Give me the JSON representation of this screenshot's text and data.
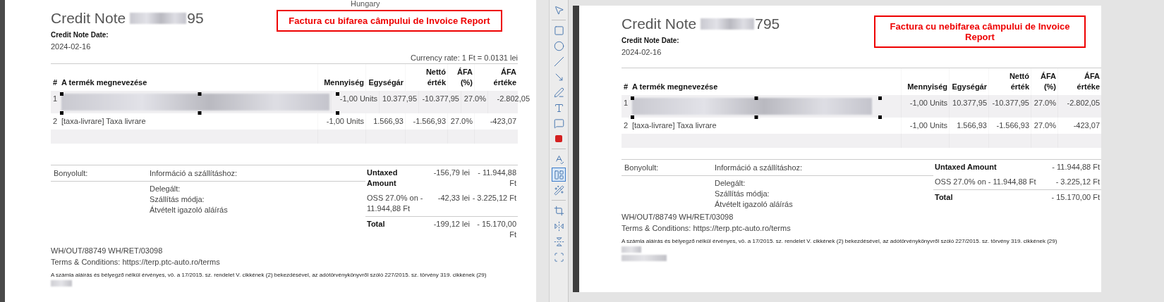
{
  "left_document": {
    "header_cut": "Hungary",
    "title": "Credit Note",
    "number_suffix": "95",
    "date_label": "Credit Note Date:",
    "date": "2024-02-16",
    "note": "Factura cu bifarea câmpului de Invoice Report",
    "currency_rate": "Currency rate: 1 Ft = 0.0131 lei",
    "columns": [
      "#",
      "A termék megnevezése",
      "Mennyiség",
      "Egységár",
      "Nettó érték",
      "ÁFA (%)",
      "ÁFA értéke"
    ],
    "rows": [
      {
        "no": "1",
        "kind": "redacted",
        "name": "",
        "quantity": "-1,00 Units",
        "unit_price": "10.377,95",
        "net": "-10.377,95",
        "vat_rate": "27.0%",
        "vat_amount": "-2.802,05"
      },
      {
        "no": "2",
        "kind": "text",
        "name": "[taxa-livrare] Taxa livrare",
        "quantity": "-1,00 Units",
        "unit_price": "1.566,93",
        "net": "-1.566,93",
        "vat_rate": "27.0%",
        "vat_amount": "-423,07"
      },
      {
        "kind": "empty"
      }
    ],
    "info": {
      "label_1": "Bonyolult:",
      "label_2": "Információ a szállításhoz:",
      "lines": [
        "Delegált:",
        "Szállítás módja:",
        "Átvételt igazoló aláírás"
      ]
    },
    "totals": [
      {
        "label": "Untaxed Amount",
        "bold": true,
        "lei": "-156,79 lei",
        "ft": "- 11.944,88 Ft"
      },
      {
        "label": "OSS 27.0% on - 11.944,88 Ft",
        "bold": false,
        "lei": "-42,33 lei",
        "ft": "- 3.225,12 Ft"
      },
      {
        "label": "Total",
        "bold": true,
        "lei": "-199,12 lei",
        "ft": "- 15.170,00 Ft"
      }
    ],
    "references": "WH/OUT/88749 WH/RET/03098",
    "terms": "Terms & Conditions: https://terp.ptc-auto.ro/terms",
    "legal": "A számla aláírás és bélyegző nélkül érvényes, vö. a 17/2015. sz. rendelet V. cikkének (2) bekezdésével, az adótörvénykönyvről szóló 227/2015. sz. törvény 319. cikkének (29)"
  },
  "toolbar": {
    "groups": [
      [
        {
          "kind": "pointer",
          "selected": false
        }
      ],
      [
        {
          "kind": "rectangle",
          "selected": false
        },
        {
          "kind": "ellipse",
          "selected": false
        },
        {
          "kind": "line",
          "selected": false
        },
        {
          "kind": "arrow",
          "selected": false
        },
        {
          "kind": "pen",
          "selected": false
        },
        {
          "kind": "text",
          "selected": false
        },
        {
          "kind": "comment",
          "selected": false
        },
        {
          "kind": "stamp",
          "selected": false
        }
      ],
      [
        {
          "kind": "spellcheck",
          "selected": false
        },
        {
          "kind": "image",
          "selected": true
        },
        {
          "kind": "wand",
          "selected": false
        }
      ],
      [
        {
          "kind": "crop",
          "selected": false
        },
        {
          "kind": "flip_h",
          "selected": false
        },
        {
          "kind": "flip_v",
          "selected": false
        },
        {
          "kind": "frame",
          "selected": false
        }
      ]
    ]
  },
  "right_document": {
    "title": "Credit Note",
    "number_suffix": "795",
    "date_label": "Credit Note Date:",
    "date": "2024-02-16",
    "note": "Factura cu nebifarea câmpului de Invoice Report",
    "columns": [
      "#",
      "A termék megnevezése",
      "Mennyiség",
      "Egységár",
      "Nettó érték",
      "ÁFA (%)",
      "ÁFA értéke"
    ],
    "rows": [
      {
        "no": "1",
        "kind": "redacted",
        "name": "",
        "quantity": "-1,00 Units",
        "unit_price": "10.377,95",
        "net": "-10.377,95",
        "vat_rate": "27.0%",
        "vat_amount": "-2.802,05"
      },
      {
        "no": "2",
        "kind": "text",
        "name": "[taxa-livrare] Taxa livrare",
        "quantity": "-1,00 Units",
        "unit_price": "1.566,93",
        "net": "-1.566,93",
        "vat_rate": "27.0%",
        "vat_amount": "-423,07"
      },
      {
        "kind": "empty"
      }
    ],
    "info": {
      "label_1": "Bonyolult:",
      "label_2": "Információ a szállításhoz:",
      "lines": [
        "Delegált:",
        "Szállítás módja:",
        "Átvételt igazoló aláírás"
      ]
    },
    "totals": [
      {
        "label": "Untaxed Amount",
        "bold": true,
        "ft": "- 11.944,88 Ft"
      },
      {
        "label": "OSS 27.0% on - 11.944,88 Ft",
        "bold": false,
        "ft": "- 3.225,12 Ft"
      },
      {
        "label": "Total",
        "bold": true,
        "ft": "- 15.170,00 Ft"
      }
    ],
    "references": "WH/OUT/88749 WH/RET/03098",
    "terms": "Terms & Conditions: https://terp.ptc-auto.ro/terms",
    "legal": "A számla aláírás és bélyegző nélkül érvényes, vö. a 17/2015. sz. rendelet V. cikkének (2) bekezdésével, az adótörvénykönyvről szóló 227/2015. sz. törvény 319. cikkének (29)"
  }
}
